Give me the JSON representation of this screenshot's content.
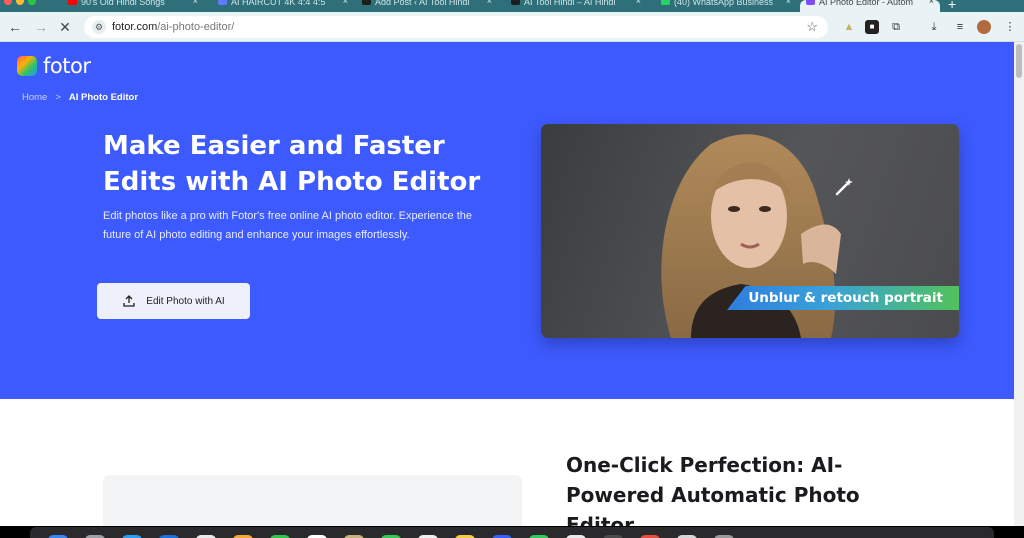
{
  "browser": {
    "tabs": [
      {
        "title": "90's Old Hindi Songs",
        "favicon_color": "#ff0000"
      },
      {
        "title": "AI HAIRCUT 4K 4:4 4:5",
        "favicon_color": "#5b7cff"
      },
      {
        "title": "Add Post ‹ AI Tool Hindi",
        "favicon_color": "#1d1d1d"
      },
      {
        "title": "AI Tool Hindi – AI Hindi",
        "favicon_color": "#1d1d1d"
      },
      {
        "title": "(40) WhatsApp Business",
        "favicon_color": "#25d366"
      },
      {
        "title": "AI Photo Editor - Autom",
        "favicon_color": "#7b4dff",
        "active": true
      }
    ],
    "url_host": "fotor.com",
    "url_path": "/ai-photo-editor/",
    "new_tab_glyph": "+"
  },
  "site": {
    "logo_text": "fotor",
    "breadcrumb": {
      "home": "Home",
      "separator": ">",
      "current": "AI Photo Editor"
    }
  },
  "hero": {
    "headline": "Make Easier and Faster Edits with AI Photo Editor",
    "description": "Edit photos like a pro with Fotor's free online AI photo editor. Experience the future of AI photo editing and enhance your images effortlessly.",
    "cta_label": "Edit Photo with AI",
    "cta_icon": "upload-icon",
    "image_banner": "Unblur & retouch portrait",
    "image_icon": "magic-wand-icon",
    "accent": "#3d5afe"
  },
  "section": {
    "heading": "One-Click Perfection: AI-Powered Automatic Photo Editor"
  }
}
